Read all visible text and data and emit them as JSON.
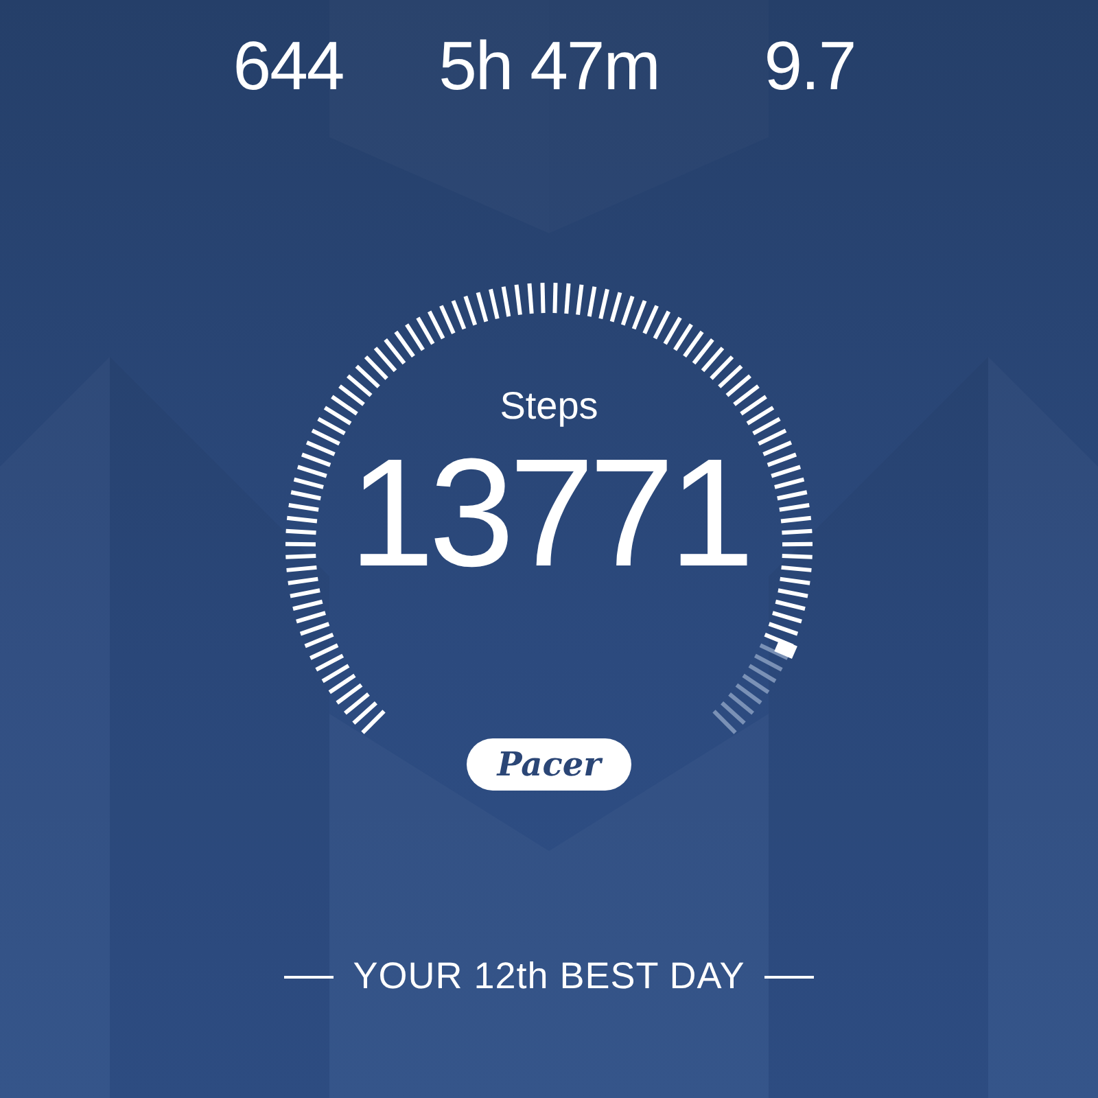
{
  "stats": [
    {
      "value": "644"
    },
    {
      "value": "5h 47m"
    },
    {
      "value": "9.7"
    }
  ],
  "gauge": {
    "label": "Steps",
    "value": "13771"
  },
  "logo": {
    "text": "Pacer"
  },
  "rank": {
    "text": "YOUR 12th BEST DAY"
  }
}
